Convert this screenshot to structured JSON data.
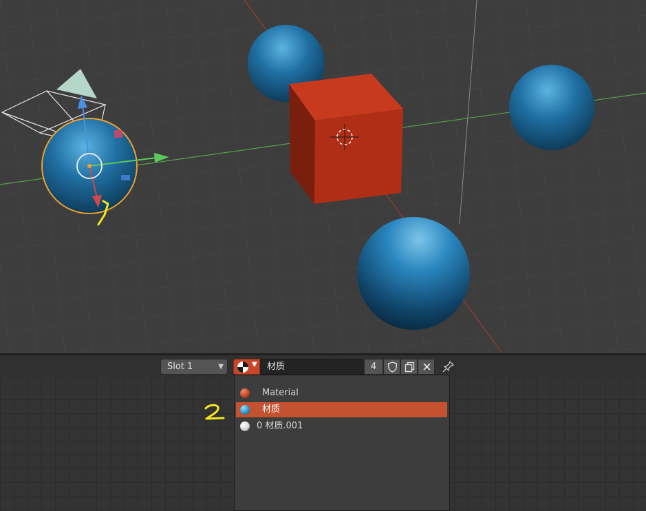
{
  "viewport": {
    "objects": [
      "sphere-selected",
      "sphere-back",
      "cube",
      "sphere-right",
      "sphere-front"
    ],
    "colors": {
      "sphere": "#1f6fa3",
      "cube": "#b9321a",
      "selection_outline": "#f0a030",
      "x_axis": "#b03535",
      "y_axis": "#5aa050"
    }
  },
  "header": {
    "slot_label": "Slot 1",
    "material_name": "材质",
    "user_count": "4",
    "icons": [
      "material-browse-icon",
      "fake-user-shield-icon",
      "duplicate-icon",
      "unlink-x-icon",
      "pin-icon"
    ]
  },
  "dropdown": {
    "items": [
      {
        "label": "Material",
        "color": "#c8472a",
        "active": false
      },
      {
        "label": "材质",
        "color": "#2a9ad0",
        "active": true
      },
      {
        "label": "0 材质.001",
        "color": "#d8d8d8",
        "active": false
      }
    ]
  },
  "annotations": {
    "mark_1": "1",
    "mark_2": "2",
    "color": "#f5e61e"
  }
}
